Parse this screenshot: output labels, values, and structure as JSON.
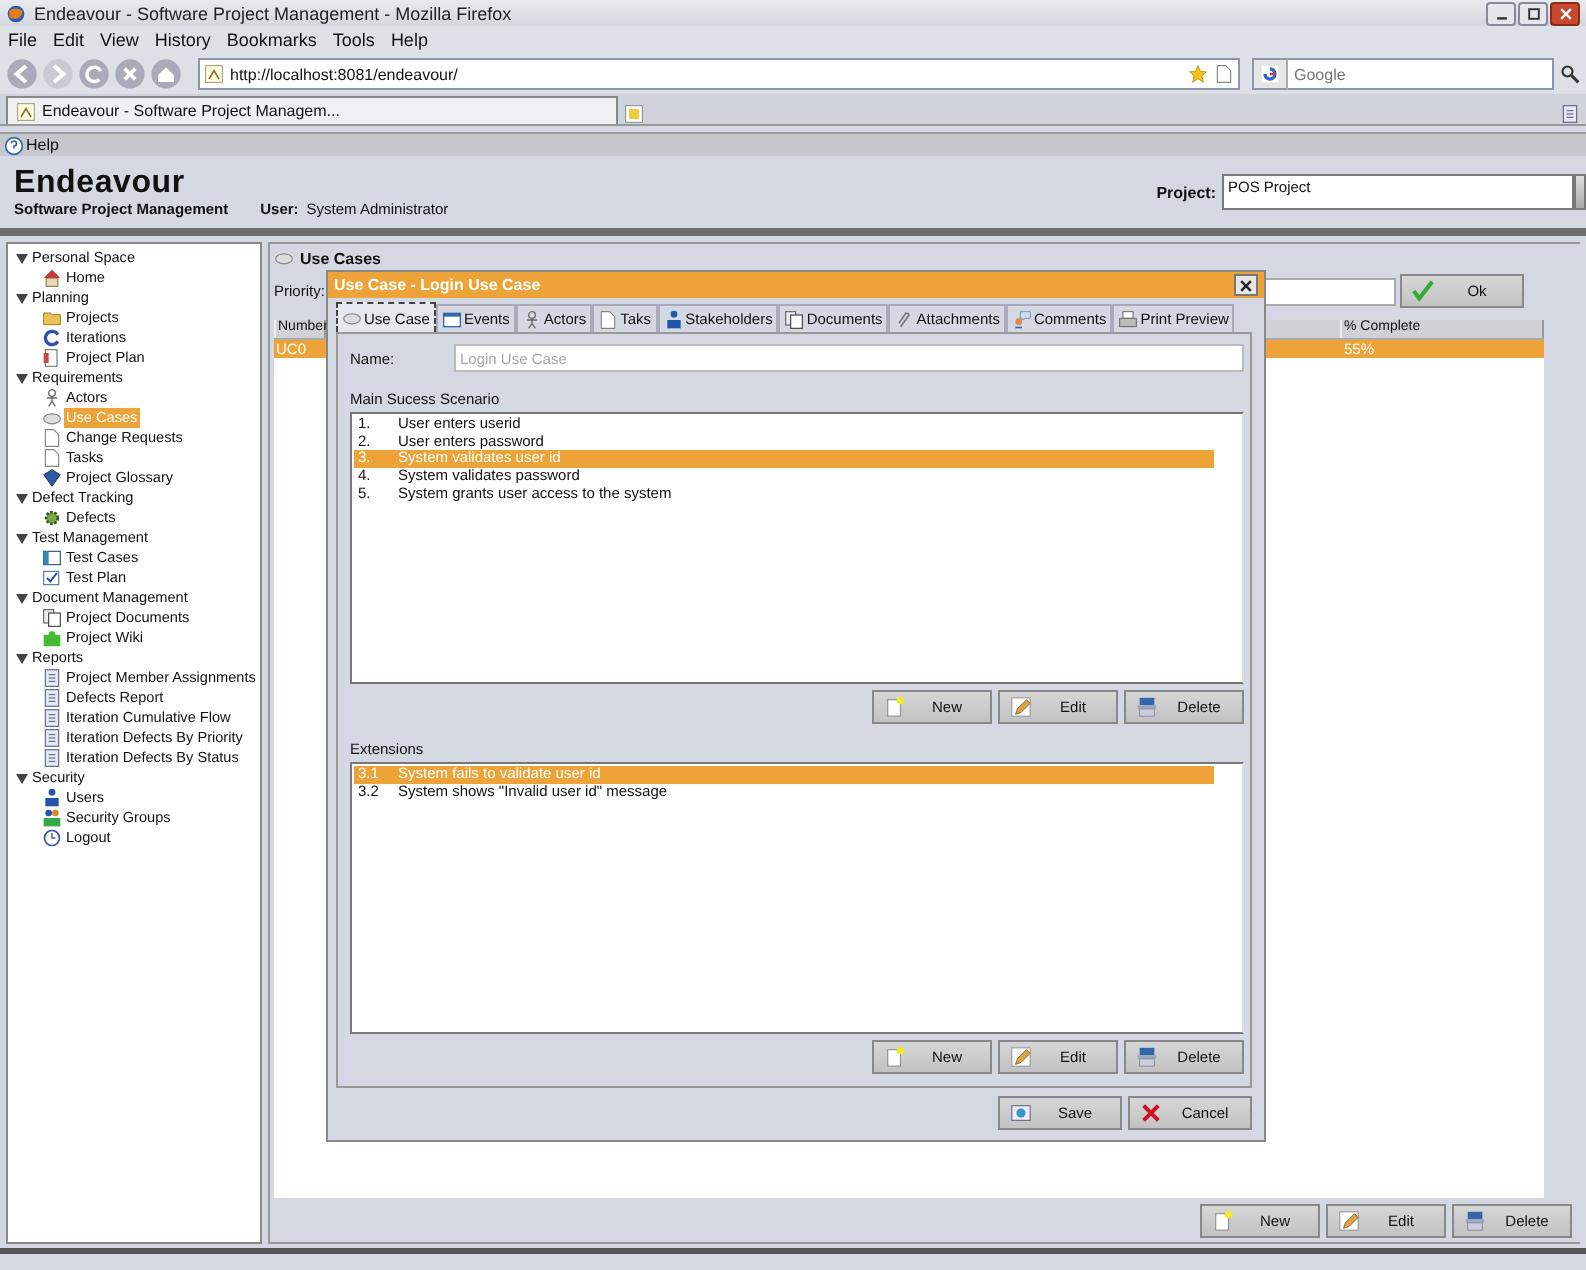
{
  "window": {
    "title": "Endeavour - Software Project Management - Mozilla Firefox"
  },
  "menu": [
    "File",
    "Edit",
    "View",
    "History",
    "Bookmarks",
    "Tools",
    "Help"
  ],
  "address_bar": {
    "value": "http://localhost:8081/endeavour/"
  },
  "search": {
    "placeholder": "Google"
  },
  "tabs": [
    {
      "label": "Endeavour - Software Project Managem...",
      "selected": true
    }
  ],
  "help_bar": {
    "label": "Help"
  },
  "header": {
    "app_name": "Endeavour",
    "subtitle": "Software Project Management",
    "user_label": "User:",
    "user_name": "System Administrator",
    "project_label": "Project:",
    "project": "POS Project"
  },
  "sidebar": {
    "groups": [
      {
        "label": "Personal Space",
        "expanded": true,
        "children": [
          {
            "label": "Home",
            "selected": false
          }
        ]
      },
      {
        "label": "Planning",
        "expanded": true,
        "children": [
          {
            "label": "Projects",
            "selected": false
          },
          {
            "label": "Iterations",
            "selected": false
          },
          {
            "label": "Project Plan",
            "selected": false
          }
        ]
      },
      {
        "label": "Requirements",
        "expanded": true,
        "children": [
          {
            "label": "Actors",
            "selected": false
          },
          {
            "label": "Use Cases",
            "selected": true
          },
          {
            "label": "Change Requests",
            "selected": false
          },
          {
            "label": "Tasks",
            "selected": false
          },
          {
            "label": "Project Glossary",
            "selected": false
          }
        ]
      },
      {
        "label": "Defect Tracking",
        "expanded": true,
        "children": [
          {
            "label": "Defects",
            "selected": false
          }
        ]
      },
      {
        "label": "Test Management",
        "expanded": true,
        "children": [
          {
            "label": "Test Cases",
            "selected": false
          },
          {
            "label": "Test Plan",
            "selected": false
          }
        ]
      },
      {
        "label": "Document Management",
        "expanded": true,
        "children": [
          {
            "label": "Project Documents",
            "selected": false
          },
          {
            "label": "Project Wiki",
            "selected": false
          }
        ]
      },
      {
        "label": "Reports",
        "expanded": true,
        "children": [
          {
            "label": "Project Member Assignments",
            "selected": false
          },
          {
            "label": "Defects Report",
            "selected": false
          },
          {
            "label": "Iteration Cumulative Flow",
            "selected": false
          },
          {
            "label": "Iteration Defects By Priority",
            "selected": false
          },
          {
            "label": "Iteration Defects By Status",
            "selected": false
          }
        ]
      },
      {
        "label": "Security",
        "expanded": true,
        "children": [
          {
            "label": "Users",
            "selected": false
          },
          {
            "label": "Security Groups",
            "selected": false
          },
          {
            "label": "Logout",
            "selected": false
          }
        ]
      }
    ]
  },
  "main": {
    "title": "Use Cases",
    "priority_label": "Priority:",
    "ok_button": "Ok",
    "table": {
      "columns": [
        "Number",
        "% Complete"
      ],
      "rows": [
        {
          "cells": [
            "UC0",
            "55%"
          ],
          "selected": true
        }
      ]
    },
    "buttons": [
      "New",
      "Edit",
      "Delete"
    ]
  },
  "dialog": {
    "title": "Use Case - Login Use Case",
    "tabs": [
      {
        "label": "Use Case",
        "selected": true
      },
      {
        "label": "Events",
        "selected": false
      },
      {
        "label": "Actors",
        "selected": false
      },
      {
        "label": "Taks",
        "selected": false
      },
      {
        "label": "Stakeholders",
        "selected": false
      },
      {
        "label": "Documents",
        "selected": false
      },
      {
        "label": "Attachments",
        "selected": false
      },
      {
        "label": "Comments",
        "selected": false
      },
      {
        "label": "Print Preview",
        "selected": false
      }
    ],
    "name_label": "Name:",
    "name_field": {
      "value": "Login Use Case",
      "disabled": true
    },
    "scenario_label": "Main Sucess Scenario",
    "scenario_steps": [
      {
        "number": "1.",
        "text": "User enters userid",
        "selected": false
      },
      {
        "number": "2.",
        "text": "User enters password",
        "selected": false
      },
      {
        "number": "3.",
        "text": "System validates user id",
        "selected": true
      },
      {
        "number": "4.",
        "text": "System validates password",
        "selected": false
      },
      {
        "number": "5.",
        "text": "System grants user access to the system",
        "selected": false
      }
    ],
    "scenario_buttons": [
      "New",
      "Edit",
      "Delete"
    ],
    "extensions_label": "Extensions",
    "extensions": [
      {
        "number": "3.1",
        "text": "System fails to validate user id",
        "selected": true
      },
      {
        "number": "3.2",
        "text": "System shows \"Invalid user id\" message",
        "selected": false
      }
    ],
    "extension_buttons": [
      "New",
      "Edit",
      "Delete"
    ],
    "footer_buttons": [
      "Save",
      "Cancel"
    ]
  }
}
